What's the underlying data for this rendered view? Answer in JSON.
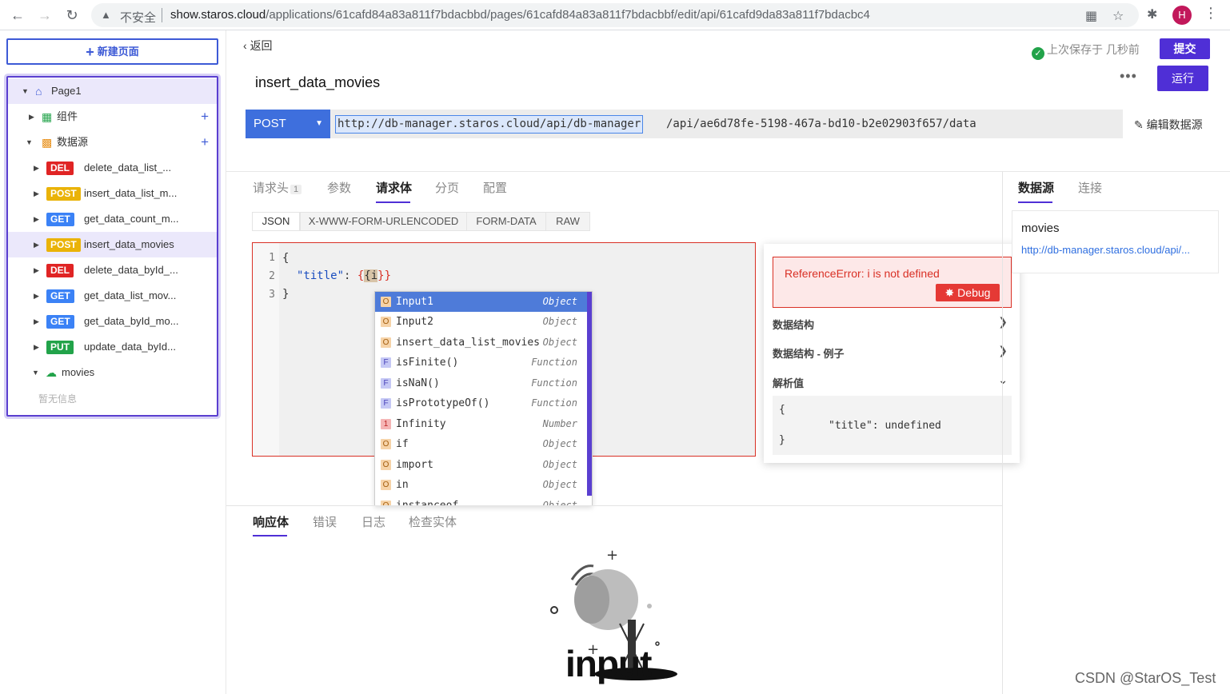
{
  "browser": {
    "insecure_label": "不安全",
    "url_host": "show.staros.cloud",
    "url_path": "/applications/61cafd84a83a811f7bdacbbd/pages/61cafd84a83a811f7bdacbbf/edit/api/61cafd9da83a811f7bdacbc4",
    "profile_initial": "H"
  },
  "sidebar": {
    "new_page_label": "新建页面",
    "page_name": "Page1",
    "widgets_label": "组件",
    "datasources_label": "数据源",
    "apis": [
      {
        "method": "DEL",
        "name": "delete_data_list_..."
      },
      {
        "method": "POST",
        "name": "insert_data_list_m..."
      },
      {
        "method": "GET",
        "name": "get_data_count_m..."
      },
      {
        "method": "POST",
        "name": "insert_data_movies"
      },
      {
        "method": "DEL",
        "name": "delete_data_byId_..."
      },
      {
        "method": "GET",
        "name": "get_data_list_mov..."
      },
      {
        "method": "GET",
        "name": "get_data_byId_mo..."
      },
      {
        "method": "PUT",
        "name": "update_data_byId..."
      }
    ],
    "db_name": "movies",
    "empty_info": "暂无信息"
  },
  "header": {
    "back_label": "返回",
    "saved_status": "上次保存于 几秒前",
    "submit_label": "提交",
    "run_label": "运行",
    "api_title": "insert_data_movies",
    "method": "POST",
    "url_base": "http://db-manager.staros.cloud/api/db-manager",
    "url_path": "/api/ae6d78fe-5198-467a-bd10-b2e02903f657/data",
    "edit_datasource_label": "编辑数据源"
  },
  "request_tabs": [
    {
      "label": "请求头",
      "count": "1"
    },
    {
      "label": "参数"
    },
    {
      "label": "请求体"
    },
    {
      "label": "分页"
    },
    {
      "label": "配置"
    }
  ],
  "body_formats": [
    "JSON",
    "X-WWW-FORM-URLENCODED",
    "FORM-DATA",
    "RAW"
  ],
  "editor": {
    "line_numbers": [
      "1",
      "2",
      "3"
    ],
    "line1": "{",
    "line2_key": "\"title\"",
    "line2_colon": ": ",
    "line2_open": "{",
    "line2_val": "{i",
    "line2_close": "}}",
    "line3": "}"
  },
  "autocomplete": [
    {
      "kind": "O",
      "name": "Input1",
      "type": "Object"
    },
    {
      "kind": "O",
      "name": "Input2",
      "type": "Object"
    },
    {
      "kind": "O",
      "name": "insert_data_list_movies",
      "type": "Object"
    },
    {
      "kind": "F",
      "name": "isFinite()",
      "type": "Function"
    },
    {
      "kind": "F",
      "name": "isNaN()",
      "type": "Function"
    },
    {
      "kind": "F",
      "name": "isPrototypeOf()",
      "type": "Function"
    },
    {
      "kind": "I",
      "name": "Infinity",
      "type": "Number"
    },
    {
      "kind": "O",
      "name": "if",
      "type": "Object"
    },
    {
      "kind": "O",
      "name": "import",
      "type": "Object"
    },
    {
      "kind": "O",
      "name": "in",
      "type": "Object"
    },
    {
      "kind": "O",
      "name": "instanceof",
      "type": "Object"
    }
  ],
  "eval": {
    "error": "ReferenceError: i is not defined",
    "debug_label": "Debug",
    "section_structure": "数据结构",
    "section_example": "数据结构 - 例子",
    "section_value": "解析值",
    "value_line1": "{",
    "value_line2": "\"title\": undefined",
    "value_line3": "}"
  },
  "right_panel": {
    "tab_datasource": "数据源",
    "tab_connection": "连接",
    "ds_name": "movies",
    "ds_url": "http://db-manager.staros.cloud/api/..."
  },
  "response_tabs": [
    "响应体",
    "错误",
    "日志",
    "检查实体"
  ],
  "illustration_text": "input",
  "watermark": "CSDN @StarOS_Test",
  "colors": {
    "primary": "#4f2fd6",
    "method_blue": "#3e6fdd",
    "error_red": "#d93025",
    "success_green": "#22a34a"
  }
}
